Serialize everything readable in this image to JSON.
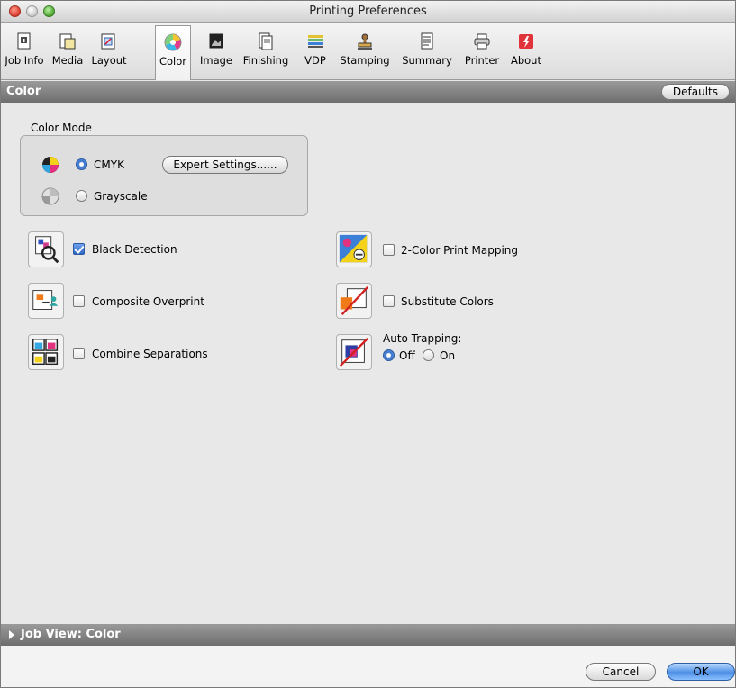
{
  "window": {
    "title": "Printing Preferences"
  },
  "toolbar": {
    "items": [
      {
        "label": "Job Info",
        "icon": "job-info-icon"
      },
      {
        "label": "Media",
        "icon": "media-icon"
      },
      {
        "label": "Layout",
        "icon": "layout-icon"
      },
      {
        "label": "Color",
        "icon": "color-wheel-icon",
        "selected": true
      },
      {
        "label": "Image",
        "icon": "image-icon"
      },
      {
        "label": "Finishing",
        "icon": "finishing-icon"
      },
      {
        "label": "VDP",
        "icon": "vdp-icon"
      },
      {
        "label": "Stamping",
        "icon": "stamp-icon"
      },
      {
        "label": "Summary",
        "icon": "summary-icon"
      },
      {
        "label": "Printer",
        "icon": "printer-icon"
      },
      {
        "label": "About",
        "icon": "about-icon"
      }
    ]
  },
  "section": {
    "title": "Color",
    "defaults_label": "Defaults"
  },
  "color_mode": {
    "label": "Color Mode",
    "options": [
      {
        "label": "CMYK",
        "selected": true,
        "icon": "cmyk-icon"
      },
      {
        "label": "Grayscale",
        "selected": false,
        "icon": "grayscale-icon"
      }
    ],
    "expert_settings_label": "Expert Settings......"
  },
  "options": {
    "black_detection": {
      "label": "Black Detection",
      "checked": true,
      "icon": "black-detection-icon"
    },
    "composite_overprint": {
      "label": "Composite Overprint",
      "checked": false,
      "icon": "composite-overprint-icon"
    },
    "combine_separations": {
      "label": "Combine Separations",
      "checked": false,
      "icon": "combine-separations-icon"
    },
    "two_color_mapping": {
      "label": "2-Color Print Mapping",
      "checked": false,
      "icon": "two-color-mapping-icon"
    },
    "substitute_colors": {
      "label": "Substitute Colors",
      "checked": false,
      "icon": "substitute-colors-icon"
    },
    "auto_trapping": {
      "label": "Auto Trapping:",
      "icon": "auto-trapping-icon",
      "options": [
        {
          "label": "Off",
          "selected": true
        },
        {
          "label": "On",
          "selected": false
        }
      ]
    }
  },
  "job_view": {
    "label": "Job View: Color"
  },
  "footer": {
    "cancel_label": "Cancel",
    "ok_label": "OK"
  },
  "colors": {
    "accent": "#3b73c8",
    "section_bar": "#7a7a7a"
  }
}
